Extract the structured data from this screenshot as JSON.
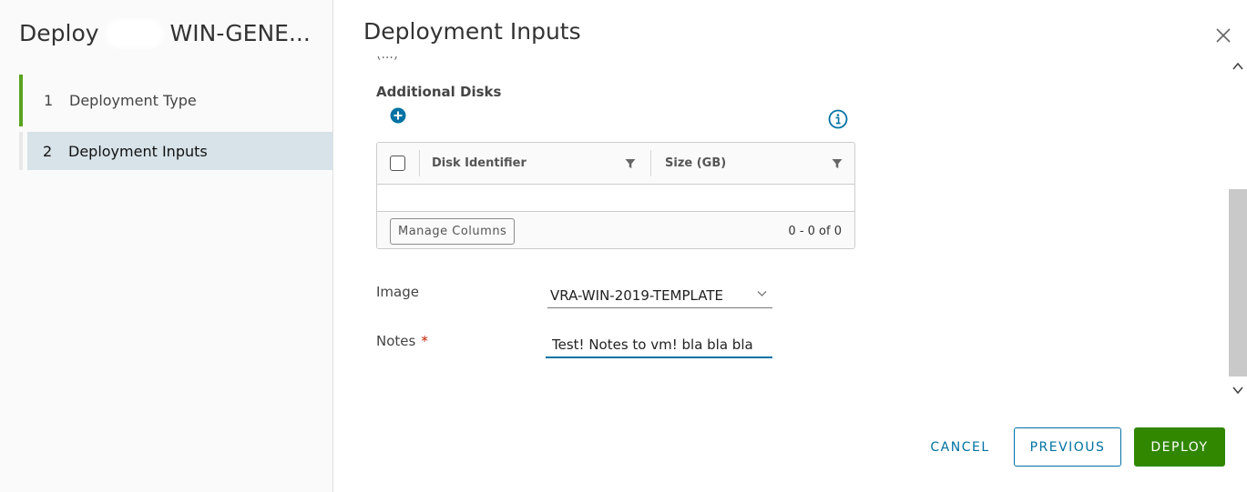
{
  "wizard": {
    "title_prefix": "Deploy",
    "title_suffix": "WIN-GENE...",
    "steps": [
      {
        "number": "1",
        "label": "Deployment Type",
        "state": "done"
      },
      {
        "number": "2",
        "label": "Deployment Inputs",
        "state": "active"
      }
    ]
  },
  "content": {
    "title": "Deployment Inputs",
    "cut_text": "(...)"
  },
  "disks": {
    "section_title": "Additional Disks",
    "columns": [
      "Disk Identifier",
      "Size (GB)"
    ],
    "manage_columns_label": "Manage Columns",
    "pager_text": "0 - 0 of 0"
  },
  "form": {
    "image_label": "Image",
    "image_value": "VRA-WIN-2019-TEMPLATE",
    "notes_label": "Notes",
    "notes_required_mark": "*",
    "notes_value": "Test! Notes to vm! bla bla bla"
  },
  "footer": {
    "cancel_label": "CANCEL",
    "previous_label": "PREVIOUS",
    "deploy_label": "DEPLOY"
  },
  "colors": {
    "primary": "#0072a3",
    "success": "#318700",
    "step_done": "#5aa220",
    "step_active_bg": "#d8e3e9",
    "required": "#c21d00"
  }
}
